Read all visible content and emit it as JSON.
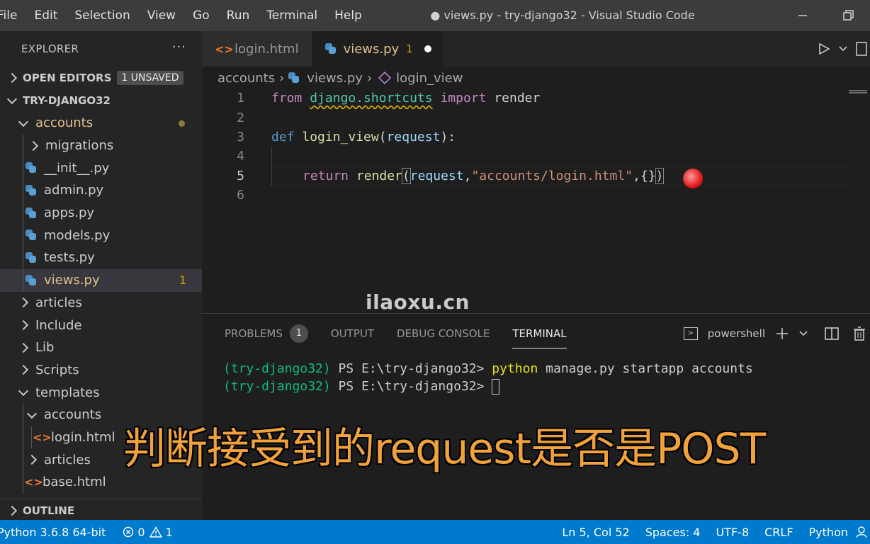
{
  "menu": [
    "File",
    "Edit",
    "Selection",
    "View",
    "Go",
    "Run",
    "Terminal",
    "Help"
  ],
  "window_title": "● views.py - try-django32 - Visual Studio Code",
  "sidebar": {
    "header": "EXPLORER",
    "more": "···",
    "open_editors": "OPEN EDITORS",
    "unsaved_badge": "1 UNSAVED",
    "project": "TRY-DJANGO32",
    "tree": [
      {
        "label": "accounts",
        "kind": "folder-open",
        "depth": 1,
        "modified": true
      },
      {
        "label": "migrations",
        "kind": "folder",
        "depth": 2
      },
      {
        "label": "__init__.py",
        "kind": "py",
        "depth": 2
      },
      {
        "label": "admin.py",
        "kind": "py",
        "depth": 2
      },
      {
        "label": "apps.py",
        "kind": "py",
        "depth": 2
      },
      {
        "label": "models.py",
        "kind": "py",
        "depth": 2
      },
      {
        "label": "tests.py",
        "kind": "py",
        "depth": 2
      },
      {
        "label": "views.py",
        "kind": "py",
        "depth": 2,
        "selected": true,
        "problems": "1"
      },
      {
        "label": "articles",
        "kind": "folder",
        "depth": 1
      },
      {
        "label": "Include",
        "kind": "folder",
        "depth": 1
      },
      {
        "label": "Lib",
        "kind": "folder",
        "depth": 1
      },
      {
        "label": "Scripts",
        "kind": "folder",
        "depth": 1
      },
      {
        "label": "templates",
        "kind": "folder-open",
        "depth": 1
      },
      {
        "label": "accounts",
        "kind": "folder-open",
        "depth": 2
      },
      {
        "label": "login.html",
        "kind": "html",
        "depth": 3
      },
      {
        "label": "articles",
        "kind": "folder",
        "depth": 2
      },
      {
        "label": "base.html",
        "kind": "html",
        "depth": 1
      }
    ],
    "outline": "OUTLINE"
  },
  "tabs": [
    {
      "label": "login.html",
      "icon": "html-icon",
      "active": false
    },
    {
      "label": "views.py",
      "icon": "python-icon",
      "active": true,
      "problems": "1"
    }
  ],
  "breadcrumb": [
    "accounts",
    "views.py",
    "login_view"
  ],
  "code": {
    "line_numbers": [
      "1",
      "2",
      "3",
      "4",
      "5",
      "6"
    ],
    "l1": {
      "from": "from",
      "module": "django.shortcuts",
      "import": "import",
      "name": "render"
    },
    "l3": {
      "def": "def",
      "fn": "login_view",
      "open": "(",
      "param": "request",
      "close": "):"
    },
    "l5": {
      "ret": "return",
      "fn": "render",
      "open": "(",
      "arg": "request",
      "comma": ",",
      "str": "\"accounts/login.html\"",
      "rest": ",{}",
      "close": ")"
    }
  },
  "watermark": "ilaoxu.cn",
  "panel": {
    "tabs": [
      "PROBLEMS",
      "OUTPUT",
      "DEBUG CONSOLE",
      "TERMINAL"
    ],
    "problems_count": "1",
    "shell": "powershell",
    "terminal": {
      "line1_env": "(try-django32)",
      "line1_ps": " PS E:\\try-django32> ",
      "line1_cmd": "python",
      "line1_args": " manage.py startapp accounts",
      "line2_env": "(try-django32)",
      "line2_ps": " PS E:\\try-django32> "
    }
  },
  "subtitle": "判断接受到的request是否是POST",
  "status": {
    "interpreter": "Python 3.6.8 64-bit",
    "errors": "0",
    "warnings": "1",
    "position": "Ln 5, Col 52",
    "spaces": "Spaces: 4",
    "encoding": "UTF-8",
    "eol": "CRLF",
    "language": "Python"
  }
}
